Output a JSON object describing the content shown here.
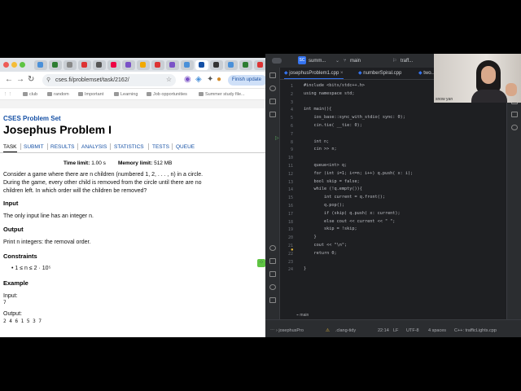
{
  "browser": {
    "url": "cses.fi/problemset/task/2162/",
    "finish_update": "Finish update",
    "bookmarks": [
      "club",
      "random",
      "Important",
      "Learning",
      "Job opportunities",
      "Summer study file..."
    ],
    "colors": {
      "red": "#ee5b56",
      "yellow": "#f5bd38",
      "green": "#5fc443"
    }
  },
  "cses": {
    "site_title": "CSES Problem Set",
    "problem_title": "Josephus Problem I",
    "menu": [
      "TASK",
      "SUBMIT",
      "RESULTS",
      "ANALYSIS",
      "STATISTICS",
      "TESTS",
      "QUEUE"
    ],
    "time_limit_label": "Time limit:",
    "time_limit_value": "1.00 s",
    "memory_limit_label": "Memory limit:",
    "memory_limit_value": "512 MB",
    "statement": [
      "Consider a game where there are n children (numbered 1, 2, . . . , n) in a circle.",
      "During the game, every other child is removed from the circle until there are no",
      "children left. In which order will the children be removed?"
    ],
    "input_heading": "Input",
    "input_text": "The only input line has an integer n.",
    "output_heading": "Output",
    "output_text": "Print n integers: the removal order.",
    "constraints_heading": "Constraints",
    "constraint": "1 ≤ n ≤ 2 · 10⁵",
    "example_heading": "Example",
    "ex_input_label": "Input:",
    "ex_input_value": "7",
    "ex_output_label": "Output:",
    "ex_output_value": "2 4 6 1 5 3 7"
  },
  "ide": {
    "project": "summ...",
    "branch": "main",
    "run_config": "traff...",
    "tabs": [
      "josephusProblem1.cpp",
      "numberSpiral.cpp",
      "two..."
    ],
    "gutter_label": "main",
    "code_lines": [
      "#include <bits/stdc++.h>",
      "using namespace std;",
      "",
      "int main(){",
      "    ios_base::sync_with_stdio( sync: 0);",
      "    cin.tie( __tie: 0);",
      "",
      "    int n;",
      "    cin >> n;",
      "",
      "    queue<int> q;",
      "    for (int i=1; i<=n; i++) q.push( x: i);",
      "    bool skip = false;",
      "    while (!q.empty()){",
      "        int current = q.front();",
      "        q.pop();",
      "        if (skip) q.push( x: current);",
      "        else cout << current << \" \";",
      "        skip = !skip;",
      "    }",
      "    cout << \"\\n\";",
      "    return 0;",
      "",
      "}"
    ],
    "status": {
      "breadcrumb": "josephusPro",
      "lint": ".clang-tidy",
      "position": "22:14",
      "line_ending": "LF",
      "encoding": "UTF-8",
      "indent": "4 spaces",
      "context": "C++: trafficLights.cpp"
    }
  },
  "webcam": {
    "label": "snow yan"
  }
}
